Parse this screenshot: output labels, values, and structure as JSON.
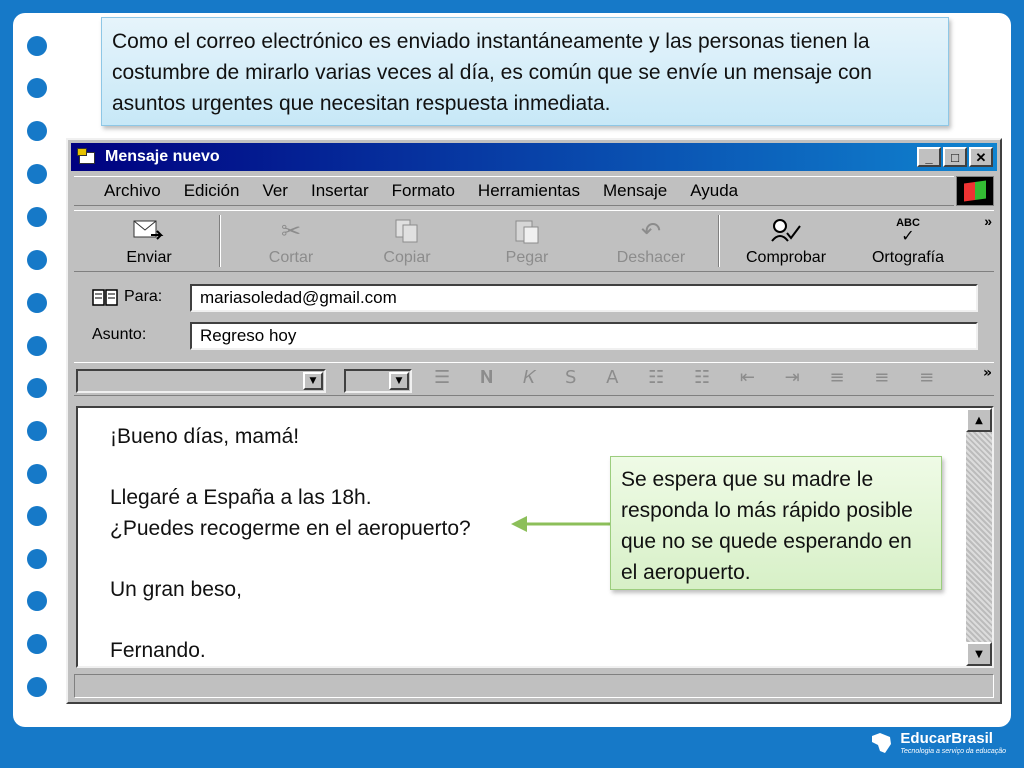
{
  "slide": {
    "intro_text": "Como el correo electrónico es enviado instantáneamente y las personas tienen la costumbre de mirarlo varias veces al día, es común que se envíe un mensaje con asuntos urgentes que necesitan respuesta inmediata.",
    "side_note": "Se espera que su madre le responda lo más rápido posible que no se quede esperando en el aeropuerto."
  },
  "window": {
    "title": "Mensaje nuevo",
    "controls": {
      "minimize": "_",
      "maximize": "□",
      "close": "✕"
    }
  },
  "menu": [
    "Archivo",
    "Edición",
    "Ver",
    "Insertar",
    "Formato",
    "Herramientas",
    "Mensaje",
    "Ayuda"
  ],
  "toolbar": {
    "send": "Enviar",
    "cut": "Cortar",
    "copy": "Copiar",
    "paste": "Pegar",
    "undo": "Deshacer",
    "check": "Comprobar",
    "spelling": "Ortografía",
    "spelling_icon_text": "ABC",
    "more": "»"
  },
  "fields": {
    "to_label": "Para:",
    "to_value": "mariasoledad@gmail.com",
    "subject_label": "Asunto:",
    "subject_value": "Regreso hoy"
  },
  "format_toolbar": {
    "more": "»"
  },
  "message": {
    "greeting": "¡Bueno días, mamá!",
    "line1": "Llegaré a España a las 18h.",
    "line2": "¿Puedes recogerme en el aeropuerto?",
    "closing": "Un gran beso,",
    "signature": "Fernando."
  },
  "brand": {
    "name": "EducarBrasil",
    "tagline": "Tecnologia a serviço da educação"
  },
  "colors": {
    "background": "#1679c8",
    "titlebar": "#000080",
    "callout_blue": "#c7e8f7",
    "callout_green": "#d7f0c7",
    "arrow": "#8cbf5a"
  },
  "icons": {
    "send": "send-icon",
    "cut": "scissors-icon",
    "copy": "copy-icon",
    "paste": "paste-icon",
    "undo": "undo-icon",
    "check": "check-names-icon",
    "spelling": "spellcheck-icon",
    "to": "address-book-icon"
  }
}
